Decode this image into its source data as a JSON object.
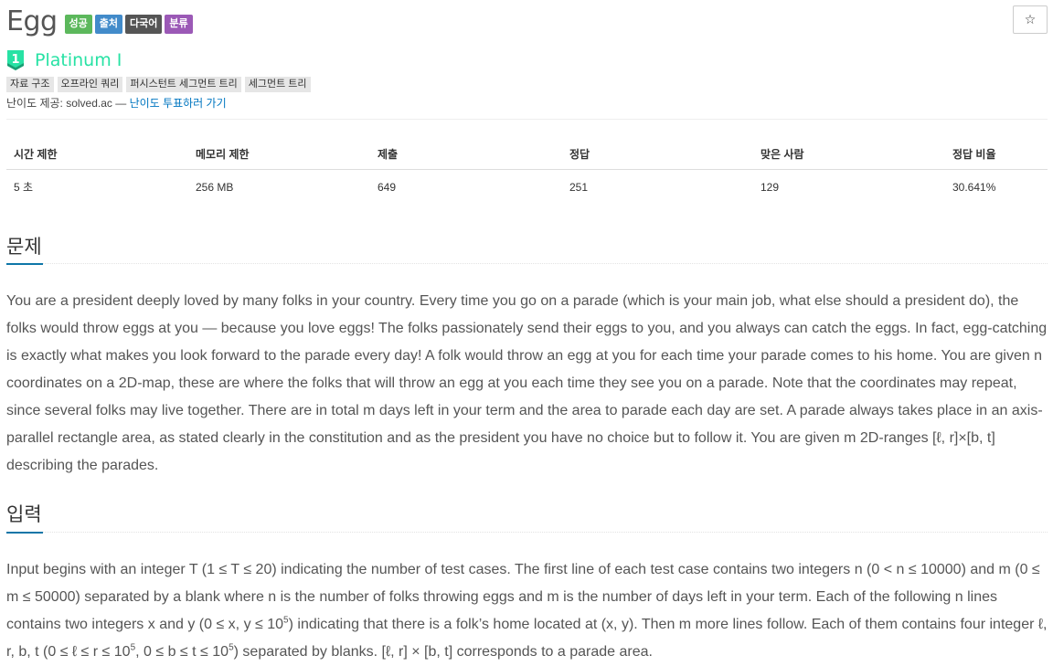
{
  "problem": {
    "title": "Egg",
    "badges": [
      {
        "label": "성공",
        "color": "#5cb85c"
      },
      {
        "label": "출처",
        "color": "#428bca"
      },
      {
        "label": "다국어",
        "color": "#555555"
      },
      {
        "label": "분류",
        "color": "#9b59b6"
      }
    ],
    "star_icon": "☆",
    "tier": {
      "number": "1",
      "label": "Platinum I",
      "color": "#27e2a4"
    },
    "tags": [
      "자료 구조",
      "오프라인 쿼리",
      "퍼시스턴트 세그먼트 트리",
      "세그먼트 트리"
    ],
    "difficulty_provider": {
      "prefix": "난이도 제공: solved.ac —",
      "link": "난이도 투표하러 가기"
    }
  },
  "stats": {
    "headers": [
      "시간 제한",
      "메모리 제한",
      "제출",
      "정답",
      "맞은 사람",
      "정답 비율"
    ],
    "values": [
      "5 초",
      "256 MB",
      "649",
      "251",
      "129",
      "30.641%"
    ]
  },
  "sections": {
    "problem_heading": "문제",
    "problem_text": "You are a president deeply loved by many folks in your country. Every time you go on a parade (which is your main job, what else should a president do), the folks would throw eggs at you — because you love eggs! The folks passionately send their eggs to you, and you always can catch the eggs. In fact, egg-catching is exactly what makes you look forward to the parade every day! A folk would throw an egg at you for each time your parade comes to his home. You are given n coordinates on a 2D-map, these are where the folks that will throw an egg at you each time they see you on a parade. Note that the coordinates may repeat, since several folks may live together. There are in total m days left in your term and the area to parade each day are set. A parade always takes place in an axis-parallel rectangle area, as stated clearly in the constitution and as the president you have no choice but to follow it. You are given m 2D-ranges [ℓ, r]×[b, t] describing the parades.",
    "input_heading": "입력",
    "input_text_1": "Input begins with an integer T (1 ≤ T ≤ 20) indicating the number of test cases. The first line of each test case contains two integers n (0 < n ≤ 10000) and m (0 ≤ m ≤ 50000) separated by a blank where n is the number of folks throwing eggs and m is the number of days left in your term. Each of the following n lines contains two integers x and y (0 ≤ x, y ≤ 10",
    "input_sup_1": "5",
    "input_text_2": ") indicating that there is a folk’s home located at (x, y). Then m more lines follow. Each of them contains four integer ℓ, r, b, t (0 ≤ ℓ ≤ r ≤ 10",
    "input_sup_2": "5",
    "input_text_3": ", 0 ≤ b ≤ t ≤ 10",
    "input_sup_3": "5",
    "input_text_4": ") separated by blanks. [ℓ, r] × [b, t] corresponds to a parade area."
  }
}
